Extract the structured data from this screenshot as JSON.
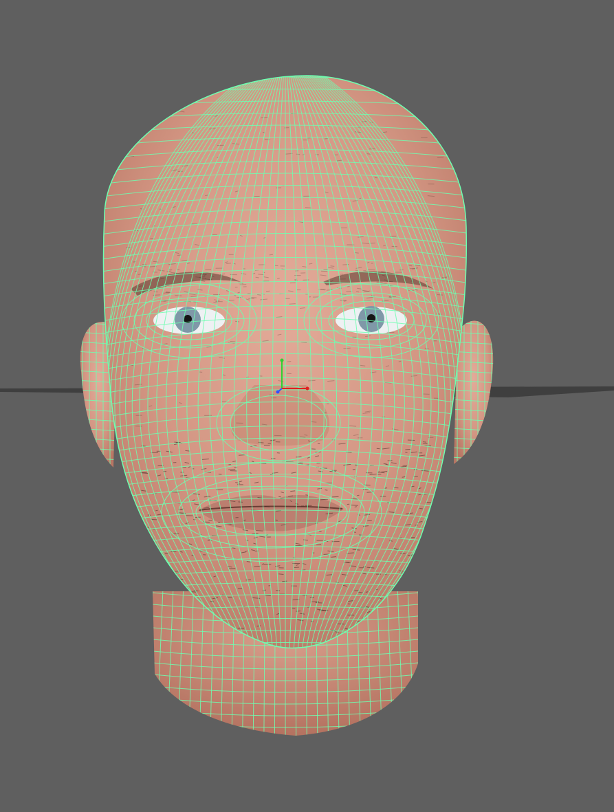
{
  "viewport": {
    "background": "#5f5f5f",
    "shading_mode": "textured-with-wireframe",
    "wireframe_color": "#6dffb0",
    "skin_color": "#d59a88",
    "iris_color": "#7f98a8",
    "ground_grid_color": "#3f3f3f",
    "object": "head-mesh",
    "manipulator": {
      "axes": [
        {
          "axis": "x",
          "color": "#e02020"
        },
        {
          "axis": "y",
          "color": "#30d030"
        },
        {
          "axis": "z",
          "color": "#3050ff"
        }
      ]
    }
  }
}
